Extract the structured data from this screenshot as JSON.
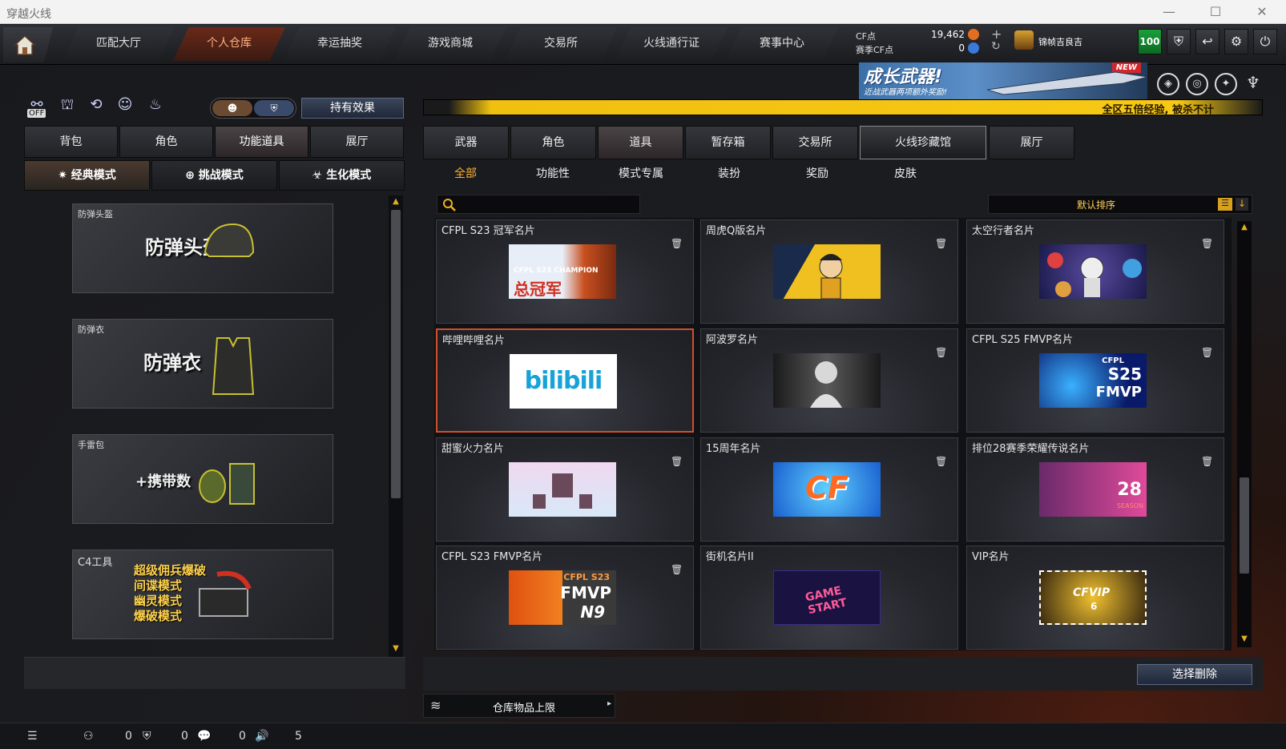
{
  "app": {
    "title": "穿越火线"
  },
  "window_controls": {
    "minimize": "—",
    "maximize": "☐",
    "close": "✕"
  },
  "nav": {
    "tabs": [
      {
        "label": "匹配大厅"
      },
      {
        "label": "个人仓库"
      },
      {
        "label": "幸运抽奖"
      },
      {
        "label": "游戏商城"
      },
      {
        "label": "交易所"
      },
      {
        "label": "火线通行证"
      },
      {
        "label": "赛事中心"
      }
    ],
    "active_tab": "个人仓库"
  },
  "currency": {
    "cf_label": "CF点",
    "cf_value": "19,462",
    "season_label": "赛季CF点",
    "season_value": "0"
  },
  "user": {
    "name": "锦帧吉良吉",
    "level": "100"
  },
  "banner": {
    "title": "成长武器!",
    "subtitle": "近战武器两项额外奖励!",
    "badge": "NEW"
  },
  "event_bar": {
    "text": "全区五倍经验, 被杀不计"
  },
  "left": {
    "off_label": "OFF",
    "hold_effect": "持有效果",
    "tabs": [
      {
        "label": "背包"
      },
      {
        "label": "角色"
      },
      {
        "label": "功能道具"
      },
      {
        "label": "展厅"
      }
    ],
    "active_tab": "功能道具",
    "modes": [
      {
        "label": "经典模式"
      },
      {
        "label": "挑战模式"
      },
      {
        "label": "生化模式"
      }
    ],
    "active_mode": "经典模式",
    "items": [
      {
        "title": "防弹头盔",
        "art_text": "防弹头盔"
      },
      {
        "title": "防弹衣",
        "art_text": "防弹衣"
      },
      {
        "title": "手雷包",
        "art_text": "+携带数"
      },
      {
        "title": "C4工具",
        "art_lines": [
          "超级佣兵爆破",
          "间谍模式",
          "幽灵模式",
          "爆破模式"
        ]
      }
    ]
  },
  "right": {
    "tabs": [
      {
        "label": "武器"
      },
      {
        "label": "角色"
      },
      {
        "label": "道具"
      },
      {
        "label": "暂存箱"
      },
      {
        "label": "交易所"
      },
      {
        "label": "火线珍藏馆"
      },
      {
        "label": "展厅"
      }
    ],
    "active_tab": "道具",
    "subtabs": [
      {
        "label": "全部"
      },
      {
        "label": "功能性"
      },
      {
        "label": "模式专属"
      },
      {
        "label": "装扮"
      },
      {
        "label": "奖励"
      },
      {
        "label": "皮肤"
      }
    ],
    "active_subtab": "全部",
    "search_placeholder": "",
    "sort_label": "默认排序",
    "cards": [
      {
        "title": "CFPL S23 冠军名片",
        "art": "总冠军",
        "art_sub": "CFPL S23 CHAMPION"
      },
      {
        "title": "周虎Q版名片",
        "art": ""
      },
      {
        "title": "太空行者名片",
        "art": ""
      },
      {
        "title": "哔哩哔哩名片",
        "art": "bilibili"
      },
      {
        "title": "阿波罗名片",
        "art": ""
      },
      {
        "title": "CFPL S25 FMVP名片",
        "art": "S25",
        "art_sub": "CFPL",
        "art_sub2": "FMVP"
      },
      {
        "title": "甜蜜火力名片",
        "art": ""
      },
      {
        "title": "15周年名片",
        "art": "CF"
      },
      {
        "title": "排位28赛季荣耀传说名片",
        "art": "28",
        "art_sub": "SEASON"
      },
      {
        "title": "CFPL S23 FMVP名片",
        "art": "FMVP",
        "art_sub": "CFPL S23",
        "art_sub2": "N9"
      },
      {
        "title": "街机名片II",
        "art": "GAME START"
      },
      {
        "title": "VIP名片",
        "art": "CFVIP",
        "art_sub": "6"
      }
    ],
    "delete_button": "选择删除",
    "capacity_label": "仓库物品上限"
  },
  "statusbar": {
    "friends": "0",
    "guild": "0",
    "chat": "0",
    "volume": "5"
  },
  "colors": {
    "accent": "#d0502a",
    "gold": "#f7c816",
    "level_green": "#1aa03a"
  }
}
